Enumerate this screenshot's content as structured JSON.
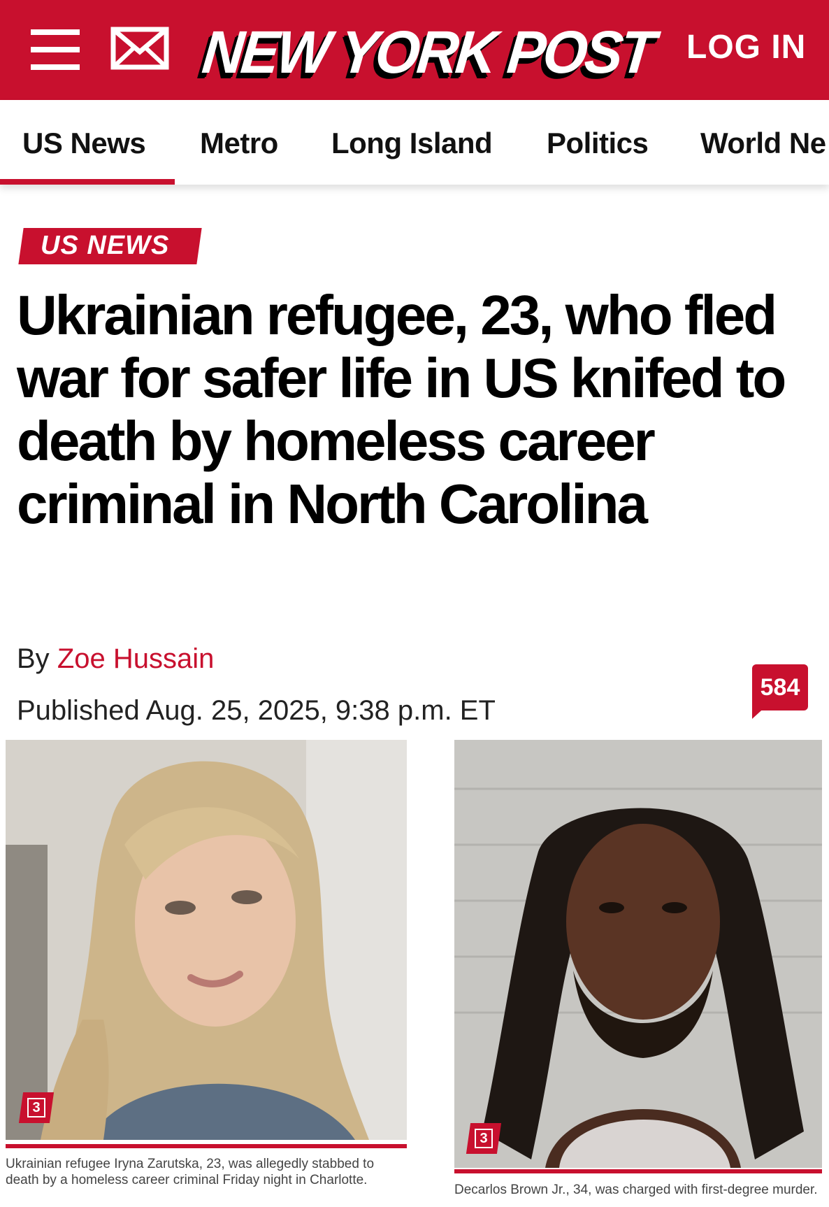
{
  "header": {
    "logo_text": "NEW YORK POST",
    "login_label": "LOG IN"
  },
  "nav": {
    "items": [
      {
        "label": "US News",
        "active": true
      },
      {
        "label": "Metro",
        "active": false
      },
      {
        "label": "Long Island",
        "active": false
      },
      {
        "label": "Politics",
        "active": false
      },
      {
        "label": "World Ne",
        "active": false
      }
    ]
  },
  "article": {
    "section": "US NEWS",
    "headline": "Ukrainian refugee, 23, who fled war for safer life in US knifed to death by homeless career criminal in North Carolina",
    "by_label": "By",
    "author": "Zoe Hussain",
    "published": "Published Aug. 25, 2025, 9:38 p.m. ET",
    "comment_count": "584"
  },
  "photos": [
    {
      "count": "3",
      "caption": "Ukrainian refugee Iryna Zarutska, 23, was allegedly stabbed to death by a homeless career criminal Friday night in Charlotte."
    },
    {
      "count": "3",
      "caption": "Decarlos Brown Jr., 34, was charged with first-degree murder."
    }
  ],
  "colors": {
    "brand_red": "#c8102e"
  },
  "icons": {
    "menu": "hamburger-menu-icon",
    "mail": "envelope-icon",
    "comments": "speech-bubble-icon",
    "gallery": "gallery-count-icon"
  }
}
